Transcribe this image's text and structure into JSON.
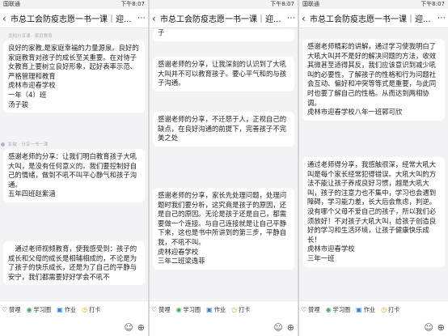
{
  "panels": [
    {
      "status_left": "国联通",
      "status_right": "下午8:07",
      "title": "市总工会防疫志愿一书一课｜迎...",
      "top_fragment": "",
      "posts": [
        {
          "meta": "龙柏分享课 · 家庭教育",
          "text": "良好的家教,是家庭幸福的力量源泉。良好的家庭教育对孩子的成长至关重要。在对待子女教育上要树立良好形象，起好表率示范、严格管理和教育\n虎林市迎春学校\n一年（4）班\n汤子骏"
        },
        {
          "meta": "彭敏 · 分享一书一课",
          "text": "感谢老师的分享：让我们明白教育孩子大吼大叫，是没有任何意义的。我们要控制好自己的情绪，做到不吼不叫平心静气和孩子沟通。\n五年四班赵紫涵"
        },
        {
          "meta": "",
          "text": "通过老师视频教育，使我感受到：孩子的成长和父母的成长是相辅相成的，不论是为了孩子的快乐成长，还是为了自己的平静与安宁，我们都需要好好学会不吼不"
        }
      ],
      "toolbar": [
        "赞哩",
        "学习圈",
        "作业",
        "打卡"
      ]
    },
    {
      "status_left": "",
      "status_right": "下午8:07",
      "title": "市总工会防疫志愿一书一课｜迎...",
      "top_fragment": "子",
      "posts": [
        {
          "meta": "",
          "text": "感谢老师的分享，让我深刻的认识到了大吼大叫并不可以教育孩子。要心平气和的与孩子沟通。"
        },
        {
          "meta": "",
          "text": "感谢老师的分享，不迁怒于人，正视自己的缺点，在良好沟通的前提下，完善孩子不完美之处"
        },
        {
          "meta": "",
          "text": "感谢老师的分享，家长先处理问题，处理问题时我们要分析，这究竟是孩子的原因，还是自己的原因。无论是孩子还是自己，都需要做一个连接。与自己连接就是让自己平静下来，这也是书中所讲到的第三步，平静自我，不吼不叫。\n虎林迎春学校\n三年二班梁逸菲"
        }
      ],
      "toolbar": [
        "赞哩",
        "学习圈",
        "作业",
        "打卡"
      ]
    },
    {
      "status_left": "国联通",
      "status_right": "下午8:07",
      "title": "市总工会防疫志愿一书一课｜迎...",
      "top_fragment": "",
      "posts": [
        {
          "meta": "",
          "text": "感谢老师精彩的讲解，通过学习使我明白了大吼大叫并不是好的解决问题的方法，收效其微甚至适得其反，我们应该意识到减少吼叫的必要性，了解孩子的性格和行为问题社会互动、偏好和冲突等等式是重要，与此同时也要了解自己的性格。从而达到两相协调。\n虎林市迎春学校八年一班郭可欣"
        },
        {
          "meta": "",
          "text": "通过老师得分享，我感触很深，经常大吼大叫是每个家长经常犯得错误。大吼大叫的方法不能让孩子养成良好习惯，越是大吼大叫，孩子的注意力也不集中，学习也会遇到障碍，学习能力差，长大后会焦虑，判逆。没有哪个父母不爱自己的孩子，所以我们必须放好！不对孩子大吼大叫，给孩子创造良好的学习和生活环境，让孩子健康快乐成长！\n虎林市迎春学校\n三年一班"
        }
      ],
      "toolbar": [
        "赞哩",
        "学习圈",
        "作业",
        "打卡"
      ]
    }
  ]
}
